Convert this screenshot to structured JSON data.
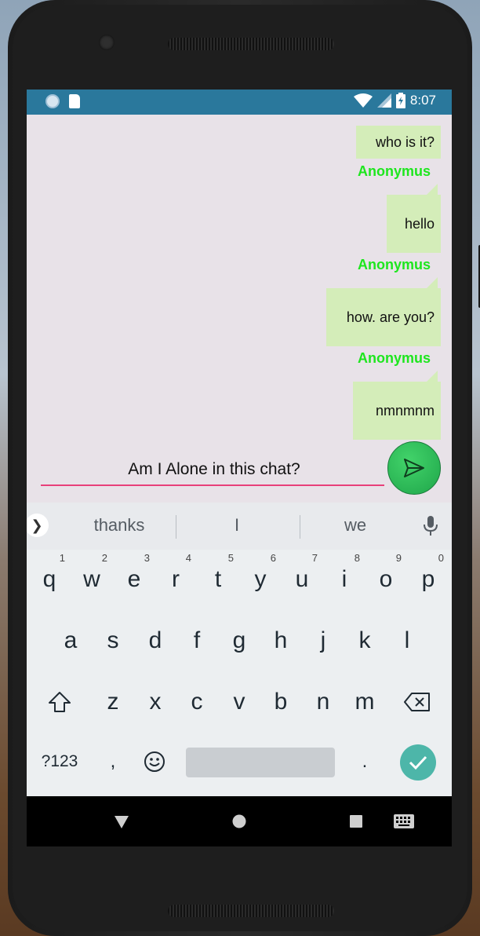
{
  "status_bar": {
    "time": "8:07",
    "left_icons": [
      "notification-dot-icon",
      "sd-card-icon"
    ],
    "right_icons": [
      "wifi-icon",
      "signal-icon",
      "battery-icon"
    ]
  },
  "chat": {
    "messages": [
      {
        "text": "who is it?",
        "sender": ""
      },
      {
        "text": "hello",
        "sender": "Anonymus"
      },
      {
        "text": "how. are you?",
        "sender": "Anonymus"
      },
      {
        "text": "nmnmnm",
        "sender": "Anonymus"
      }
    ],
    "sender_color": "#1ee61e",
    "bubble_color": "#d4edb9"
  },
  "composer": {
    "input_value": "Am I Alone in this chat?",
    "accent_color": "#e8407a",
    "send_icon": "send-icon"
  },
  "keyboard": {
    "suggestions": [
      "thanks",
      "I",
      "we"
    ],
    "row1": [
      {
        "k": "q",
        "h": "1"
      },
      {
        "k": "w",
        "h": "2"
      },
      {
        "k": "e",
        "h": "3"
      },
      {
        "k": "r",
        "h": "4"
      },
      {
        "k": "t",
        "h": "5"
      },
      {
        "k": "y",
        "h": "6"
      },
      {
        "k": "u",
        "h": "7"
      },
      {
        "k": "i",
        "h": "8"
      },
      {
        "k": "o",
        "h": "9"
      },
      {
        "k": "p",
        "h": "0"
      }
    ],
    "row2": [
      "a",
      "s",
      "d",
      "f",
      "g",
      "h",
      "j",
      "k",
      "l"
    ],
    "row3": [
      "z",
      "x",
      "c",
      "v",
      "b",
      "n",
      "m"
    ],
    "bottom": {
      "symbols": "?123",
      "comma": ",",
      "period": "."
    }
  },
  "navbar": {
    "icons": [
      "back-icon",
      "home-icon",
      "recents-icon",
      "keyboard-switch-icon"
    ]
  }
}
